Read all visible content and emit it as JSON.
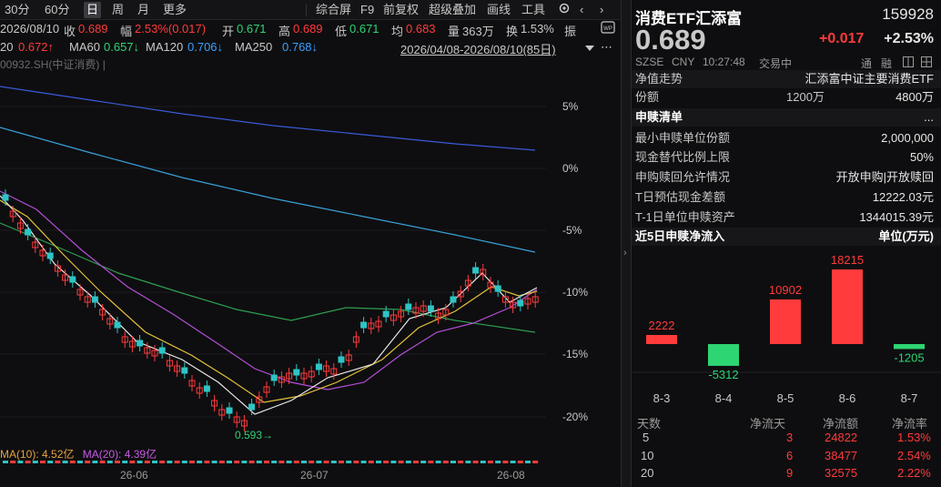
{
  "toolbar": {
    "period_tabs": [
      "30分",
      "60分",
      "日",
      "周",
      "月",
      "更多"
    ],
    "active_tab": "日",
    "tools": [
      "综合屏",
      "F9",
      "前复权",
      "超级叠加",
      "画线",
      "工具"
    ]
  },
  "ohlc": {
    "date": "2026/08/10",
    "close_label": "收",
    "close": "0.689",
    "range_label": "幅",
    "range": "2.53%(0.017)",
    "open_label": "开",
    "open": "0.671",
    "high_label": "高",
    "high": "0.689",
    "low_label": "低",
    "low": "0.671",
    "avg_label": "均",
    "avg": "0.683",
    "vol_label": "量",
    "vol": "363万",
    "turn_label": "换",
    "turn": "1.53%",
    "amp_label": "振"
  },
  "ma": {
    "ma20_label": "20",
    "ma20": "0.672↑",
    "ma60_label": "MA60",
    "ma60": "0.657↓",
    "ma120_label": "MA120",
    "ma120": "0.706↓",
    "ma250_label": "MA250",
    "ma250": "0.768↓",
    "range_text": "2026/04/08-2026/08/10(85日)"
  },
  "index_label": "00932.SH(中证消费) |",
  "pct_ticks": [
    "5%",
    "0%",
    "-5%",
    "-10%",
    "-15%",
    "-20%"
  ],
  "low_marker": "0.593→",
  "volume": {
    "ma10": "MA(10): 4.52亿",
    "ma20": "MA(20): 4.39亿"
  },
  "x_axis": [
    "26-06",
    "26-07",
    "26-08"
  ],
  "quote": {
    "name": "消费ETF汇添富",
    "code": "159928",
    "price": "0.689",
    "change": "+0.017",
    "change_pct": "+2.53%",
    "exchange": "SZSE",
    "currency": "CNY",
    "time": "10:27:48",
    "status": "交易中",
    "tags": [
      "通",
      "融"
    ]
  },
  "nav": {
    "label": "净值走势",
    "value": "汇添富中证主要消费ETF"
  },
  "shares": {
    "label": "份额",
    "v1": "1200万",
    "v2": "4800万"
  },
  "subscription": {
    "title": "申赎清单",
    "more": "...",
    "rows": [
      {
        "label": "最小申赎单位份额",
        "value": "2,000,000"
      },
      {
        "label": "现金替代比例上限",
        "value": "50%"
      },
      {
        "label": "申购赎回允许情况",
        "value": "开放申购|开放赎回"
      },
      {
        "label": "T日预估现金差额",
        "value": "12222.03元"
      },
      {
        "label": "T-1日单位申赎资产",
        "value": "1344015.39元"
      }
    ]
  },
  "flow": {
    "title": "近5日申赎净流入",
    "unit": "单位(万元)",
    "chart_data": {
      "type": "bar",
      "categories": [
        "8-3",
        "8-4",
        "8-5",
        "8-6",
        "8-7"
      ],
      "values": [
        2222,
        -5312,
        10902,
        18215,
        -1205
      ]
    },
    "labels": [
      "2222",
      "-5312",
      "10902",
      "18215",
      "-1205"
    ]
  },
  "flow_table": {
    "headers": [
      "天数",
      "净流天",
      "净流额",
      "净流率"
    ],
    "rows": [
      [
        "5",
        "3",
        "24822",
        "1.53%"
      ],
      [
        "10",
        "6",
        "38477",
        "2.54%"
      ],
      [
        "20",
        "9",
        "32575",
        "2.22%"
      ]
    ]
  },
  "colors": {
    "up": "#ff3b3b",
    "down": "#2ed573",
    "accent": "#3aa0ff"
  }
}
